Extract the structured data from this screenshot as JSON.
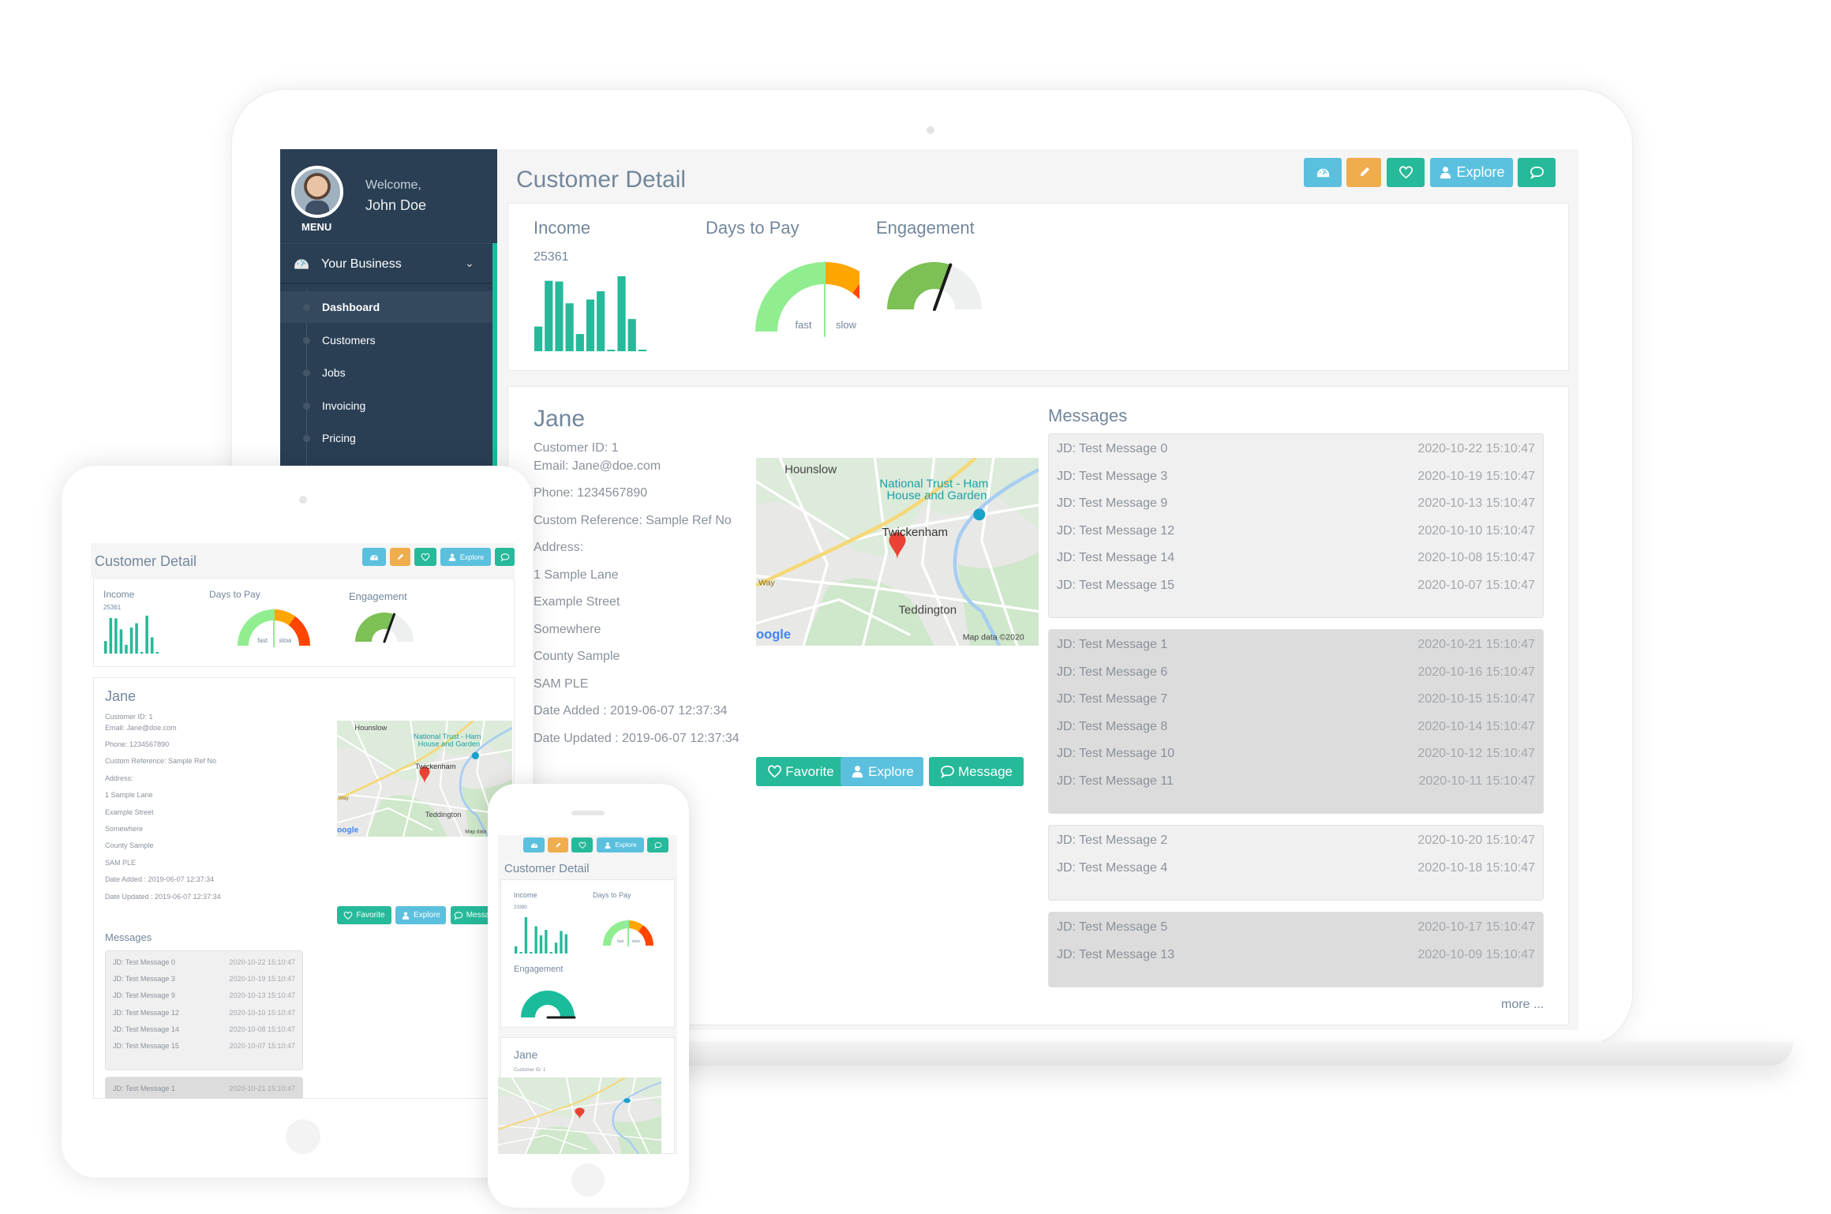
{
  "colors": {
    "sidebar": "#2a3f54",
    "accent": "#1abb9c",
    "info": "#5bc0de",
    "warning": "#f0ad4e",
    "success": "#26b99a",
    "bar": "#26b99a",
    "gauge_fast": "#90ee90",
    "gauge_mid": "#ffa500",
    "gauge_slow": "#ff4500",
    "engagement": "#7dc055",
    "engagement_phone": "#1abc9c"
  },
  "sidebar": {
    "welcome": "Welcome,",
    "user_name": "John Doe",
    "menu_label": "MENU",
    "section": "Your Business",
    "items": [
      {
        "label": "Dashboard",
        "active": true
      },
      {
        "label": "Customers"
      },
      {
        "label": "Jobs"
      },
      {
        "label": "Invoicing"
      },
      {
        "label": "Pricing"
      }
    ]
  },
  "header": {
    "title": "Customer Detail",
    "buttons": [
      {
        "icon": "dashboard-icon",
        "label": ""
      },
      {
        "icon": "pencil-icon",
        "label": ""
      },
      {
        "icon": "heart-icon",
        "label": ""
      },
      {
        "icon": "user-icon",
        "label": "Explore"
      },
      {
        "icon": "comment-icon",
        "label": ""
      }
    ]
  },
  "stats": {
    "income_label": "Income",
    "income_value": "25361",
    "income_bars": [
      33,
      94,
      93,
      64,
      23,
      69,
      80,
      1,
      100,
      43,
      1
    ],
    "phone_income_value": "23390",
    "phone_income_bars": [
      20,
      1,
      100,
      1,
      75,
      50,
      65,
      2,
      30,
      62,
      53
    ],
    "days_label": "Days to Pay",
    "days_fast": "fast",
    "days_slow": "slow",
    "days_needle": 0.5,
    "engagement_label": "Engagement",
    "engagement_level": 0.61
  },
  "customer": {
    "name": "Jane",
    "info": [
      "Customer ID: 1",
      "Email: Jane@doe.com",
      "Phone: 1234567890",
      "Custom Reference: Sample Ref No",
      "Address:",
      "1 Sample Lane",
      "Example Street",
      "Somewhere",
      "County Sample",
      "SAM PLE",
      "Date Added : 2019-06-07 12:37:34",
      "Date Updated : 2019-06-07 12:37:34"
    ],
    "map": {
      "labels": [
        "Hounslow",
        "National Trust - Ham",
        "House and Garden",
        "Twickenham",
        "Teddington",
        "Way"
      ],
      "logo": "oogle",
      "attribution": "Map data ©2020"
    },
    "actions": [
      {
        "icon": "heart-icon",
        "label": "Favorite"
      },
      {
        "icon": "user-icon",
        "label": "Explore"
      },
      {
        "icon": "comment-icon",
        "label": "Message"
      }
    ]
  },
  "messages": {
    "title": "Messages",
    "more": "more ...",
    "groups": [
      [
        {
          "text": "JD: Test Message 0",
          "date": "2020-10-22 15:10:47"
        },
        {
          "text": "JD: Test Message 3",
          "date": "2020-10-19 15:10:47"
        },
        {
          "text": "JD: Test Message 9",
          "date": "2020-10-13 15:10:47"
        },
        {
          "text": "JD: Test Message 12",
          "date": "2020-10-10 15:10:47"
        },
        {
          "text": "JD: Test Message 14",
          "date": "2020-10-08 15:10:47"
        },
        {
          "text": "JD: Test Message 15",
          "date": "2020-10-07 15:10:47"
        }
      ],
      [
        {
          "text": "JD: Test Message 1",
          "date": "2020-10-21 15:10:47"
        },
        {
          "text": "JD: Test Message 6",
          "date": "2020-10-16 15:10:47"
        },
        {
          "text": "JD: Test Message 7",
          "date": "2020-10-15 15:10:47"
        },
        {
          "text": "JD: Test Message 8",
          "date": "2020-10-14 15:10:47"
        },
        {
          "text": "JD: Test Message 10",
          "date": "2020-10-12 15:10:47"
        },
        {
          "text": "JD: Test Message 11",
          "date": "2020-10-11 15:10:47"
        }
      ],
      [
        {
          "text": "JD: Test Message 2",
          "date": "2020-10-20 15:10:47"
        },
        {
          "text": "JD: Test Message 4",
          "date": "2020-10-18 15:10:47"
        }
      ],
      [
        {
          "text": "JD: Test Message 5",
          "date": "2020-10-17 15:10:47"
        },
        {
          "text": "JD: Test Message 13",
          "date": "2020-10-09 15:10:47"
        }
      ]
    ]
  }
}
